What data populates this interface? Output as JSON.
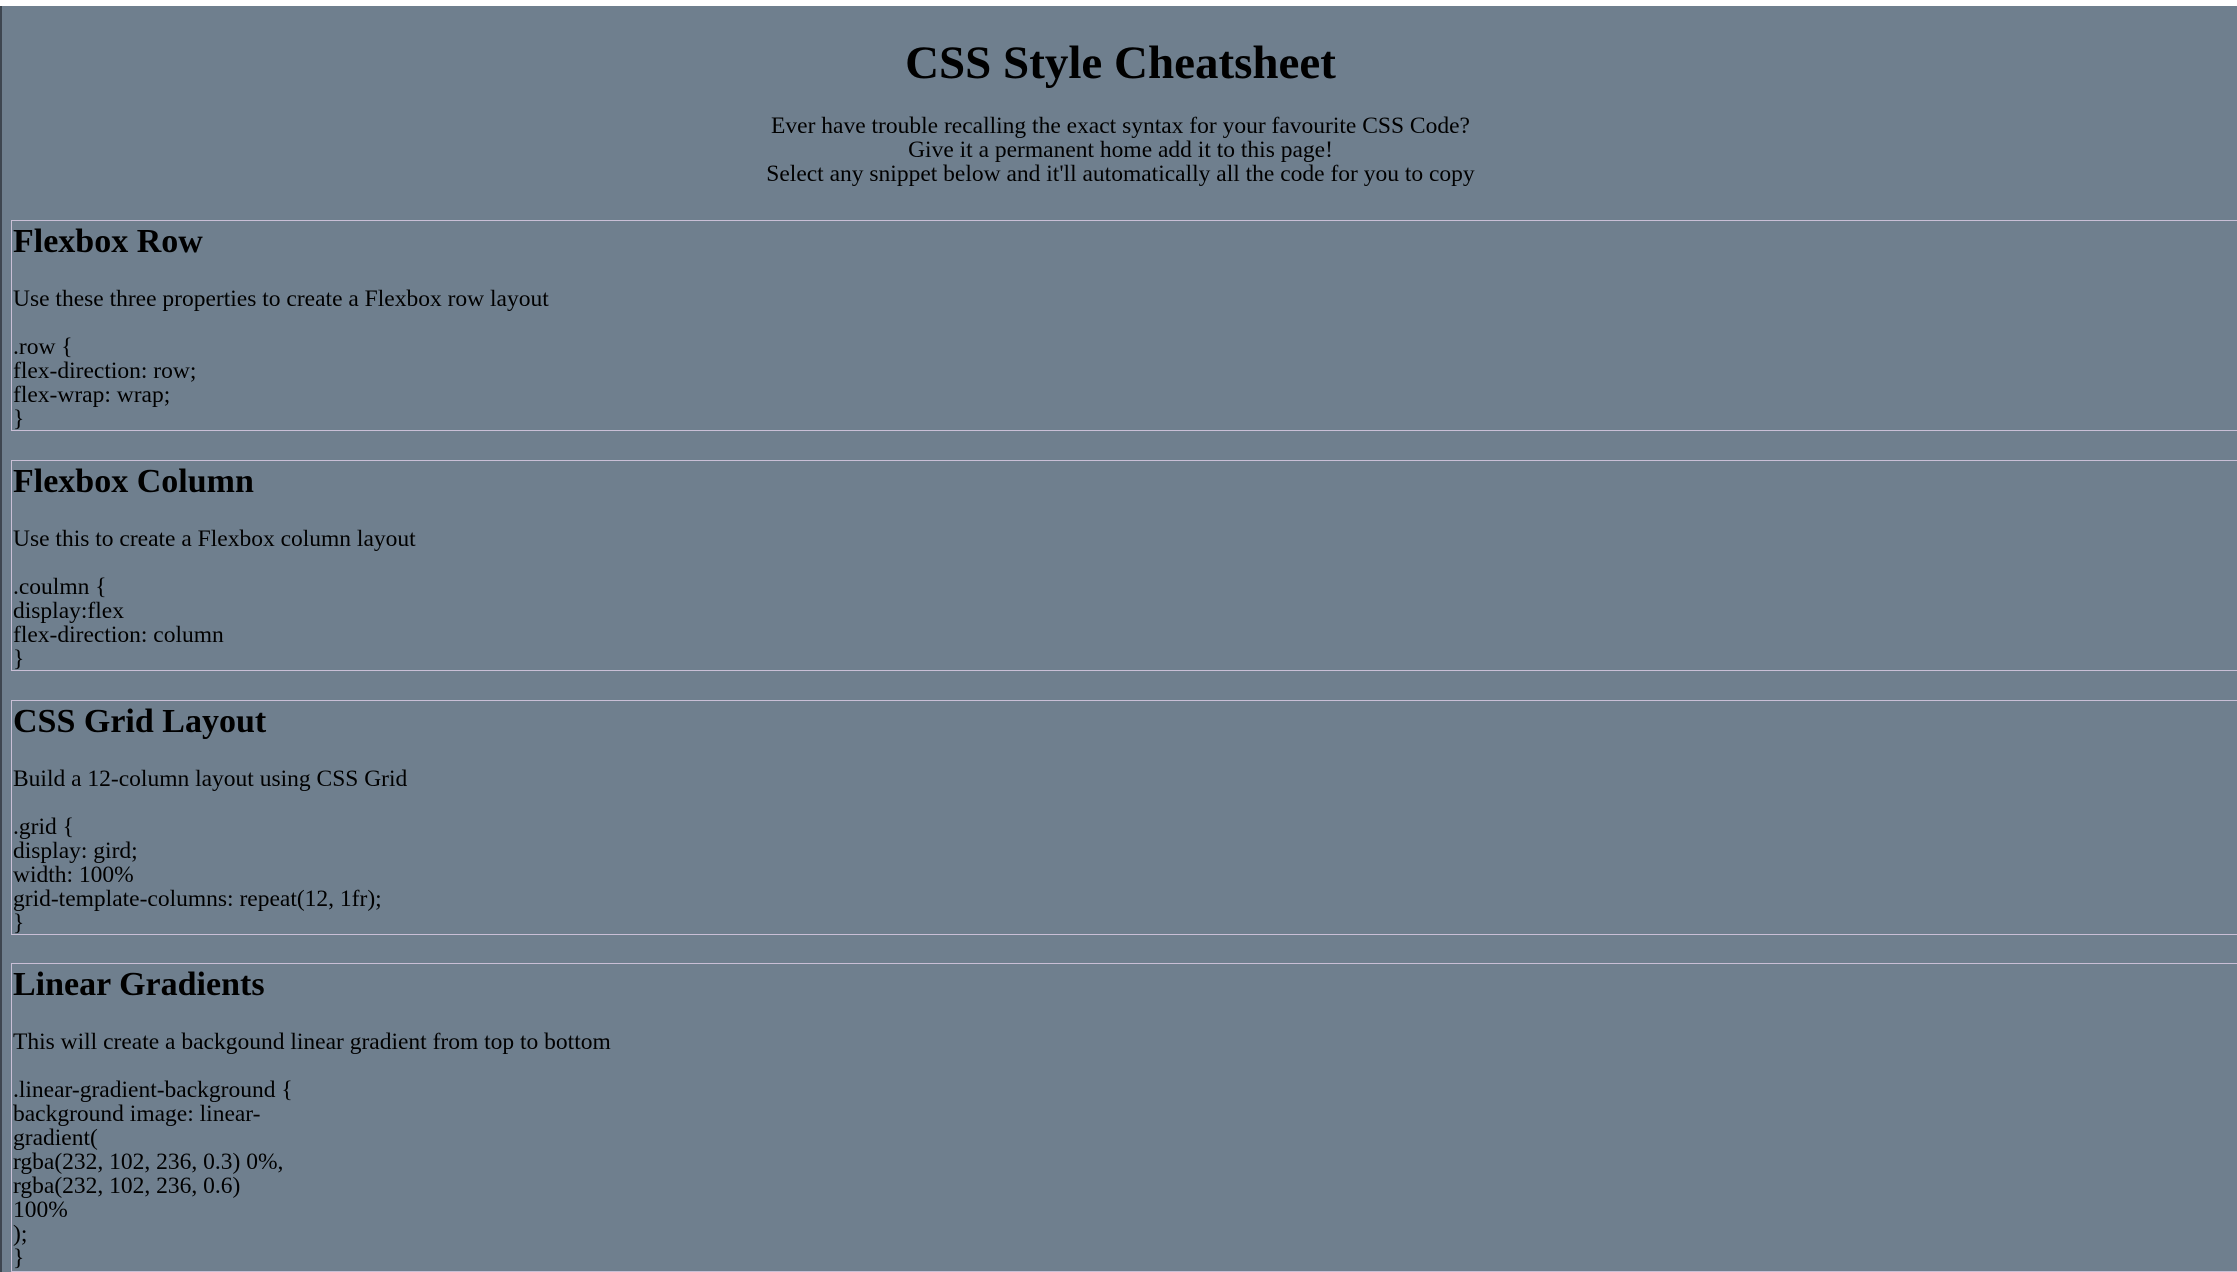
{
  "header": {
    "title": "CSS Style Cheatsheet",
    "intro_lines": [
      "Ever have trouble recalling the exact syntax for your favourite CSS Code?",
      "Give it a permanent home add it to this page!",
      "Select any snippet below and it'll automatically all the code for you to copy"
    ]
  },
  "snippets": [
    {
      "title": "Flexbox Row",
      "description": "Use these three properties to create a Flexbox row layout",
      "code_lines": [
        ".row {",
        "flex-direction: row;",
        "flex-wrap: wrap;",
        "}"
      ]
    },
    {
      "title": "Flexbox Column",
      "description": "Use this to create a Flexbox column layout",
      "code_lines": [
        ".coulmn {",
        "display:flex",
        "flex-direction: column",
        "}"
      ]
    },
    {
      "title": "CSS Grid Layout",
      "description": "Build a 12-column layout using CSS Grid",
      "code_lines": [
        ".grid {",
        "display: gird;",
        "width: 100%",
        "grid-template-columns: repeat(12, 1fr);",
        "}"
      ]
    },
    {
      "title": "Linear Gradients",
      "description": "This will create a backgound linear gradient from top to bottom",
      "code_lines": [
        ".linear-gradient-background {",
        "background image: linear-",
        "gradient(",
        "rgba(232, 102, 236, 0.3) 0%,",
        "rgba(232, 102, 236, 0.6)",
        "100%",
        ");",
        "}"
      ]
    }
  ]
}
